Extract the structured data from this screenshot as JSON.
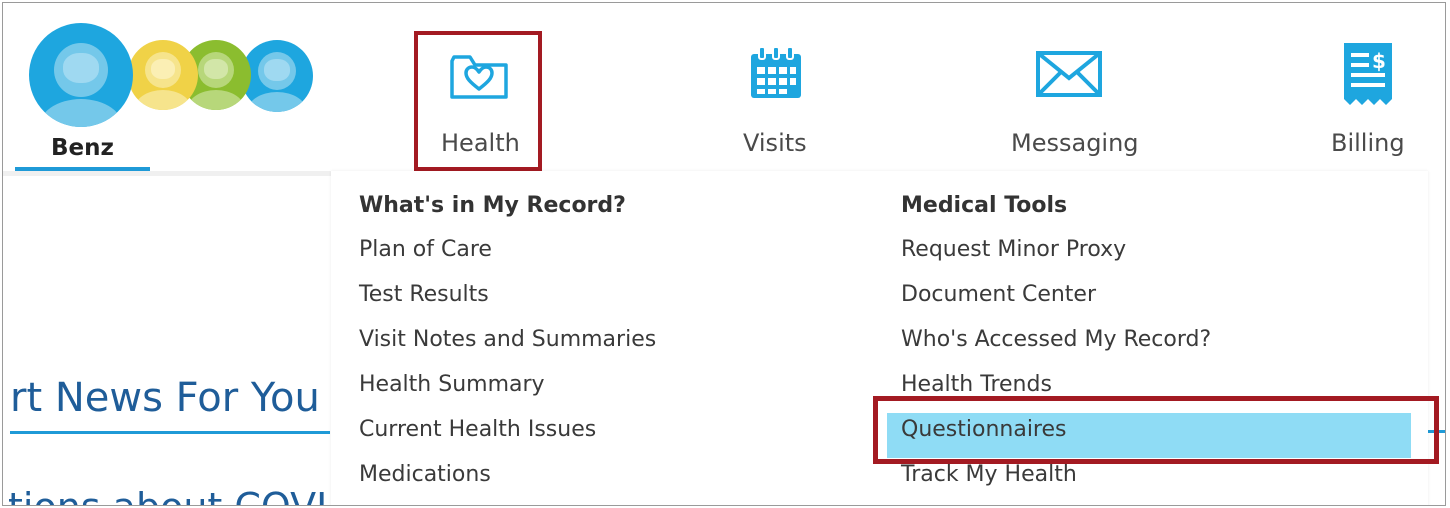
{
  "user": {
    "name": "Benz"
  },
  "nav": {
    "health": {
      "label": "Health",
      "icon": "folder-heart-icon"
    },
    "visits": {
      "label": "Visits",
      "icon": "calendar-icon"
    },
    "messaging": {
      "label": "Messaging",
      "icon": "envelope-icon"
    },
    "billing": {
      "label": "Billing",
      "icon": "bill-icon"
    }
  },
  "menu": {
    "left": {
      "heading": "What's in My Record?",
      "items": [
        "Plan of Care",
        "Test Results",
        "Visit Notes and Summaries",
        "Health Summary",
        "Current Health Issues",
        "Medications"
      ]
    },
    "right": {
      "heading": "Medical Tools",
      "items": [
        "Request Minor Proxy",
        "Document Center",
        "Who's Accessed My Record?",
        "Health Trends",
        "Questionnaires",
        "Track My Health"
      ],
      "selected": "Questionnaires"
    }
  },
  "background": {
    "news_heading": "rt News For You",
    "covid_text": "tions about COVI"
  },
  "colors": {
    "brand_blue": "#1ea6df",
    "highlight_red": "#a31a22",
    "selected_bg": "#8fdcf5",
    "heading_blue": "#1f5d99"
  }
}
